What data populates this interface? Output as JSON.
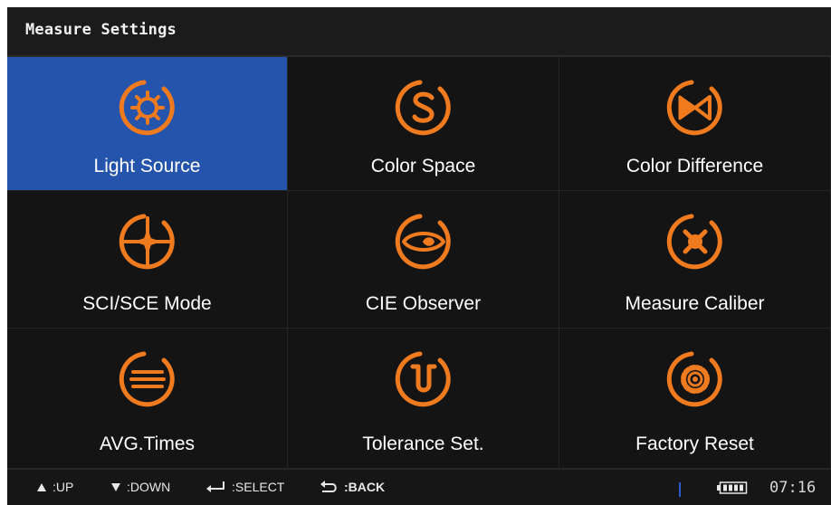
{
  "window": {
    "title": "Measure Settings"
  },
  "menu": {
    "items": [
      {
        "label": "Light Source",
        "icon": "light-source-icon",
        "selected": true
      },
      {
        "label": "Color Space",
        "icon": "color-space-icon",
        "selected": false
      },
      {
        "label": "Color Difference",
        "icon": "color-difference-icon",
        "selected": false
      },
      {
        "label": "SCI/SCE Mode",
        "icon": "sci-sce-mode-icon",
        "selected": false
      },
      {
        "label": "CIE Observer",
        "icon": "cie-observer-icon",
        "selected": false
      },
      {
        "label": "Measure Caliber",
        "icon": "measure-caliber-icon",
        "selected": false
      },
      {
        "label": "AVG.Times",
        "icon": "avg-times-icon",
        "selected": false
      },
      {
        "label": "Tolerance Set.",
        "icon": "tolerance-set-icon",
        "selected": false
      },
      {
        "label": "Factory Reset",
        "icon": "factory-reset-icon",
        "selected": false
      }
    ]
  },
  "statusbar": {
    "up": ":UP",
    "down": ":DOWN",
    "select": ":SELECT",
    "back": ":BACK",
    "time": "07:16"
  },
  "colors": {
    "accent": "#f07a1e",
    "selected_tile": "#2554ad",
    "background": "#121212"
  }
}
